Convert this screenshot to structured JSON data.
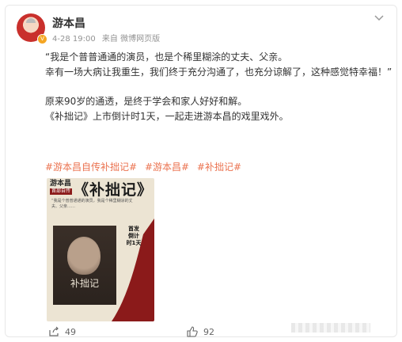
{
  "post": {
    "author": "游本昌",
    "date": "4-28 19:00",
    "source": "来自 微博网页版",
    "paragraphs": [
      "“我是个普普通通的演员，也是个稀里糊涂的丈夫、父亲。",
      "幸有一场大病让我重生，我们终于充分沟通了，也充分谅解了，这种感觉特幸福！”",
      "原来90岁的通透，是终于学会和家人好好和解。",
      "《补拙记》上市倒计时1天，一起走进游本昌的戏里戏外。"
    ],
    "tags": [
      "#游本昌自传补拙记#",
      "#游本昌#",
      "#补拙记#"
    ],
    "cover": {
      "title": "游本昌",
      "subtitle": "首部自传",
      "big_title": "《补拙记》",
      "photo_text": "补拙记",
      "countdown": "首发倒计时1天",
      "quote": "“我是个普普通通的演员，我是个稀里糊涂的丈夫、父亲……"
    },
    "actions": {
      "share_count": "49",
      "like_count": "92"
    }
  },
  "colors": {
    "tag": "#eb7350",
    "meta": "#939393",
    "accent_red": "#8b1a1a"
  }
}
